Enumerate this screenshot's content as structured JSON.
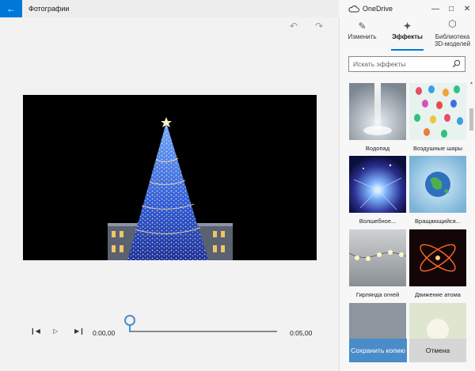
{
  "titlebar": {
    "app_title": "Фотографии",
    "onedrive_label": "OneDrive",
    "back_icon": "arrow-left-icon"
  },
  "toolbar": {
    "undo_icon": "undo-icon",
    "redo_icon": "redo-icon"
  },
  "playback": {
    "current_time": "0:00,00",
    "end_time": "0:05,00",
    "progress": 0
  },
  "panel": {
    "tabs": [
      {
        "label": "Изменить",
        "icon": "pencil-icon",
        "active": false
      },
      {
        "label": "Эффекты",
        "icon": "magic-wand-icon",
        "active": true
      },
      {
        "label": "Библиотека 3D-моделей",
        "icon": "cube-icon",
        "active": false
      }
    ],
    "search": {
      "placeholder": "Искать эффекты"
    },
    "effects": [
      {
        "label": "Водопад"
      },
      {
        "label": "Воздушные шары"
      },
      {
        "label": "Волшебное..."
      },
      {
        "label": "Вращающийся..."
      },
      {
        "label": "Гирлянда огней"
      },
      {
        "label": "Движение атома"
      }
    ],
    "actions": {
      "save_label": "Сохранить копию",
      "cancel_label": "Отмена"
    }
  },
  "colors": {
    "accent": "#0078d7",
    "primary_button": "#4a8cc9"
  }
}
